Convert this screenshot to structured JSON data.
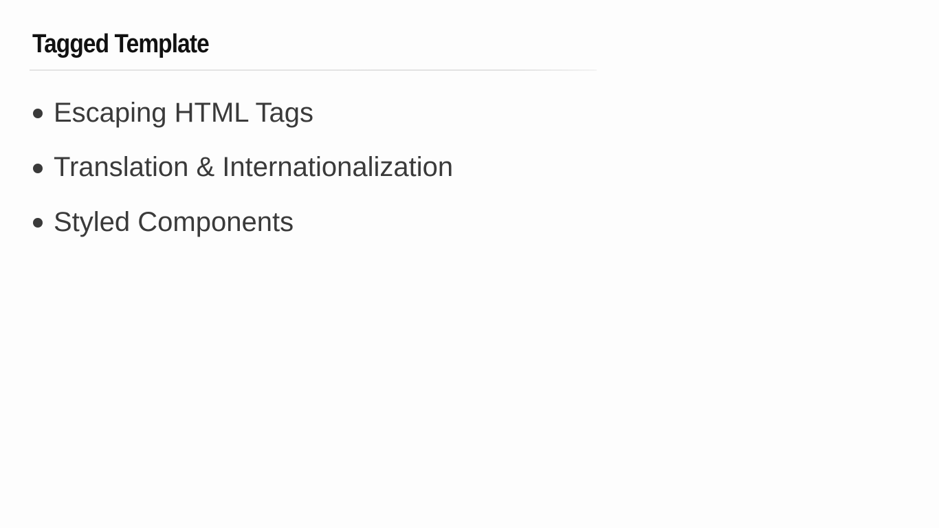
{
  "slide": {
    "title": "Tagged Template",
    "bullets": [
      "Escaping HTML Tags",
      "Translation & Internationalization",
      "Styled Components"
    ]
  }
}
